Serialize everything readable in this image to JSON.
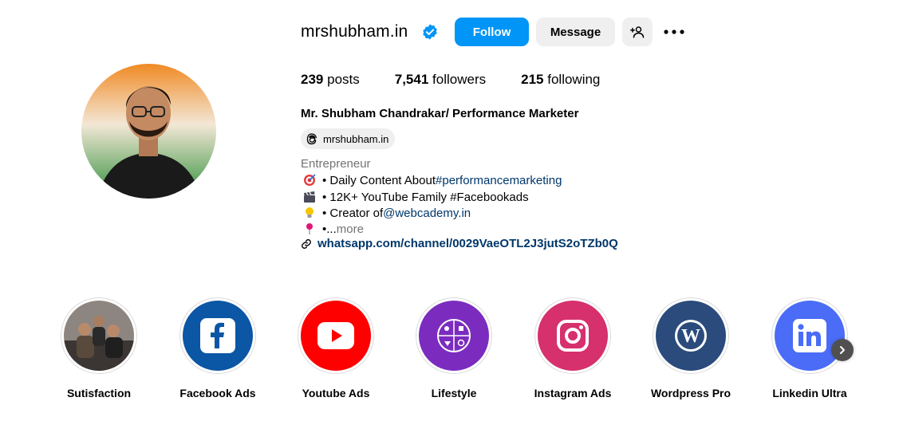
{
  "profile": {
    "username": "mrshubham.in",
    "follow_label": "Follow",
    "message_label": "Message",
    "suggest_icon": "person-plus-icon",
    "more_icon": "more-dots-icon"
  },
  "stats": {
    "posts_count": "239",
    "posts_label": "posts",
    "followers_count": "7,541",
    "followers_label": "followers",
    "following_count": "215",
    "following_label": "following"
  },
  "bio": {
    "full_name": "Mr. Shubham Chandrakar/ Performance Marketer",
    "threads_handle": "mrshubham.in",
    "category": "Entrepreneur",
    "lines": [
      {
        "emoji": "direct-hit-icon",
        "prefix": "• Daily Content About",
        "tag": "#performancemarketing",
        "suffix": ""
      },
      {
        "emoji": "clapper-board-icon",
        "prefix": "• 12K+ YouTube Family #Facebookads",
        "tag": "",
        "suffix": ""
      },
      {
        "emoji": "light-bulb-icon",
        "prefix": "• Creator of ",
        "tag": "@webcademy.in",
        "suffix": ""
      },
      {
        "emoji": "round-pushpin-icon",
        "prefix": "•...",
        "tag": "",
        "suffix": " more"
      }
    ],
    "link": "whatsapp.com/channel/0029VaeOTL2J3jutS2oTZb0Q"
  },
  "highlights": [
    {
      "label": "Sutisfaction"
    },
    {
      "label": "Facebook Ads"
    },
    {
      "label": "Youtube Ads"
    },
    {
      "label": "Lifestyle"
    },
    {
      "label": "Instagram Ads"
    },
    {
      "label": "Wordpress Pro"
    },
    {
      "label": "Linkedin Ultra"
    }
  ],
  "colors": {
    "primary_button": "#0095f6",
    "secondary_button": "#efefef",
    "link": "#00376b",
    "muted_text": "#737373",
    "verified_badge": "#0095f6",
    "facebook_blue": "#0b56a5",
    "youtube_red": "#ff0000",
    "lifestyle_purple": "#7b2cbf",
    "instagram_pink": "#d6306d",
    "wordpress_navy": "#2a4b7c",
    "linkedin_blue": "#4a6cf7"
  }
}
